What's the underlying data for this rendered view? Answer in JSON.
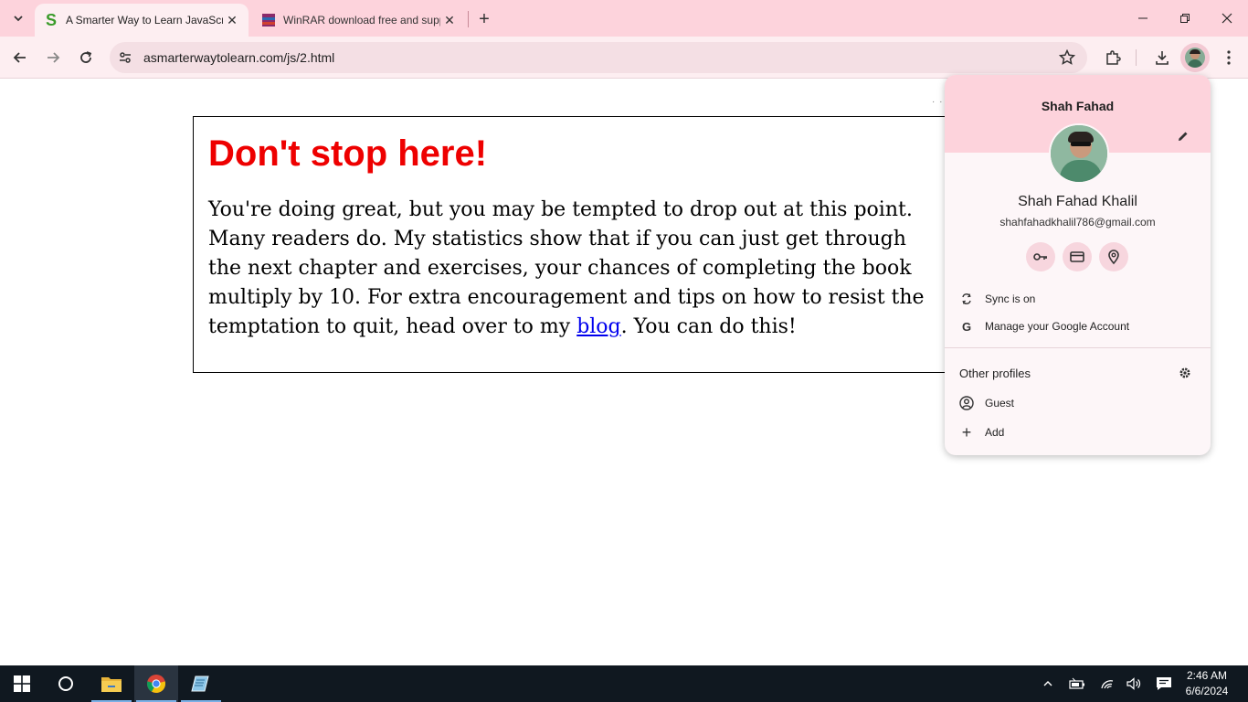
{
  "browser": {
    "tabs": [
      {
        "title": "A Smarter Way to Learn JavaScript",
        "favicon": "S",
        "active": true
      },
      {
        "title": "WinRAR download free and support",
        "favicon": "winrar",
        "active": false
      }
    ],
    "url": "asmarterwaytolearn.com/js/2.html"
  },
  "page": {
    "heading": "Don't stop here!",
    "para_before_link": "You're doing great, but you may be tempted to drop out at this point. Many readers do. My statistics show that if you can just get through the next chapter and exercises, your chances of completing the book multiply by 10. For extra encouragement and tips on how to resist the temptation to quit, head over to my ",
    "link_text": "blog",
    "para_after_link": ". You can do this!"
  },
  "profile_menu": {
    "header_name": "Shah Fahad",
    "full_name": "Shah Fahad Khalil",
    "email": "shahfahadkhalil786@gmail.com",
    "quick_actions": [
      "key-icon",
      "card-icon",
      "location-pin-icon"
    ],
    "sync_label": "Sync is on",
    "manage_label": "Manage your Google Account",
    "other_profiles_label": "Other profiles",
    "guest_label": "Guest",
    "add_label": "Add"
  },
  "taskbar": {
    "time": "2:46 AM",
    "date": "6/6/2024"
  },
  "colors": {
    "titlebar": "#fdd3dc",
    "toolbar": "#fdeef1",
    "heading": "#ee0000",
    "link": "#0000ee",
    "taskbar": "#101820"
  }
}
